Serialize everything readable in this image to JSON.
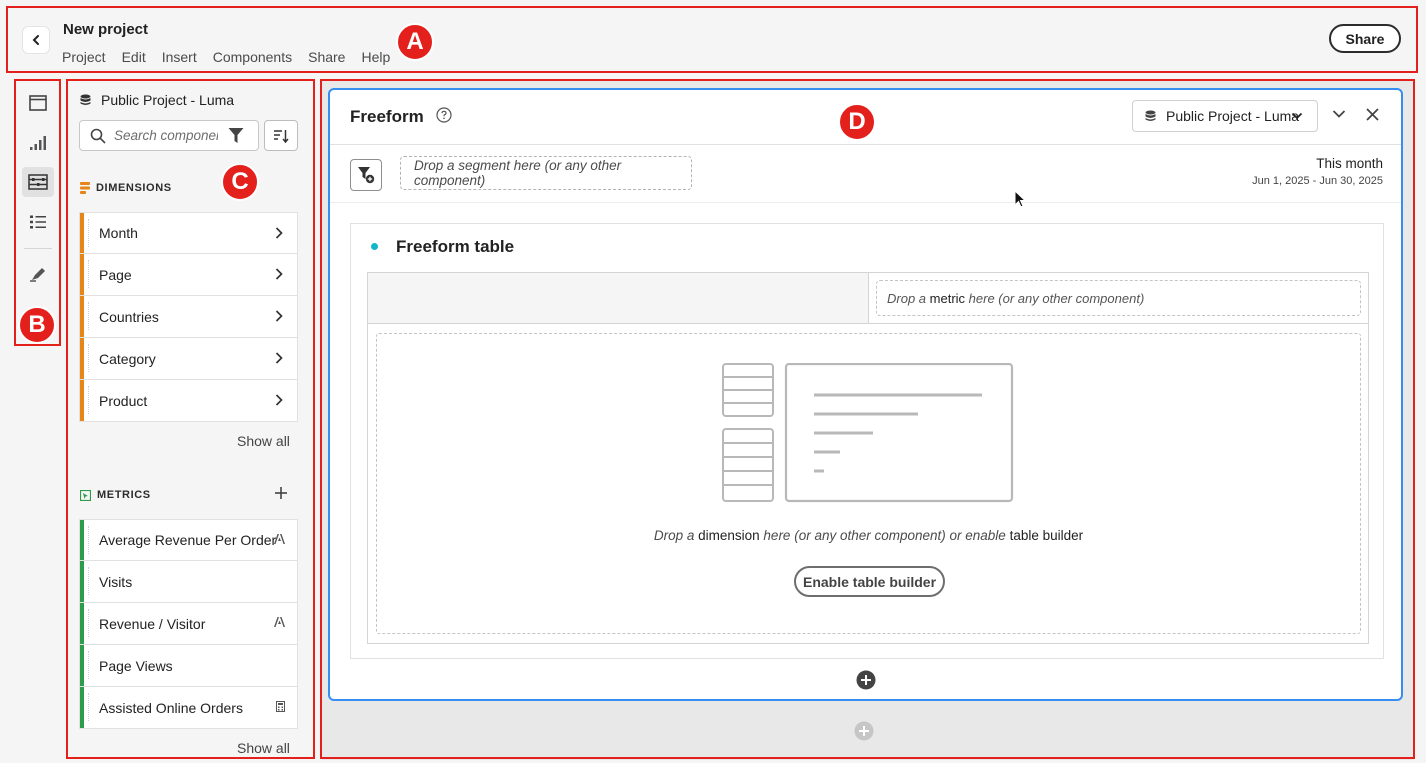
{
  "header": {
    "title": "New project",
    "menu": [
      "Project",
      "Edit",
      "Insert",
      "Components",
      "Share",
      "Help"
    ],
    "share_label": "Share"
  },
  "annotations": {
    "a": "A",
    "b": "B",
    "c": "C",
    "d": "D"
  },
  "rail": {
    "icons": [
      "panel-icon",
      "visualization-icon",
      "components-icon",
      "list-icon",
      "brush-icon"
    ],
    "active": "components-icon"
  },
  "panel": {
    "data_source": "Public Project - Luma",
    "search_placeholder": "Search components",
    "dimensions": {
      "heading": "DIMENSIONS",
      "items": [
        "Month",
        "Page",
        "Countries",
        "Category",
        "Product"
      ],
      "show_all": "Show all",
      "color": "#e68619"
    },
    "metrics": {
      "heading": "METRICS",
      "items": [
        "Average Revenue Per Order",
        "Visits",
        "Revenue / Visitor",
        "Page Views",
        "Assisted Online Orders"
      ],
      "show_all": "Show all",
      "color": "#2d9d4b"
    }
  },
  "workspace": {
    "panel_title": "Freeform",
    "data_source": "Public Project - Luma",
    "segment_drop": "Drop a segment here (or any other component)",
    "date_label": "This month",
    "date_range": "Jun 1, 2025 - Jun 30, 2025",
    "table": {
      "title": "Freeform table",
      "metric_drop_prefix": "Drop a ",
      "metric_drop_keyword": "metric",
      "metric_drop_suffix": " here (or any other component)",
      "dim_drop_prefix": "Drop a ",
      "dim_drop_keyword": "dimension",
      "dim_drop_middle": " here (or any other component) or enable ",
      "dim_drop_keyword2": "table builder",
      "enable_label": "Enable table builder"
    }
  },
  "colors": {
    "accent": "#378ef0",
    "annotation": "#e3201b",
    "table_dot": "#12b5c9"
  }
}
